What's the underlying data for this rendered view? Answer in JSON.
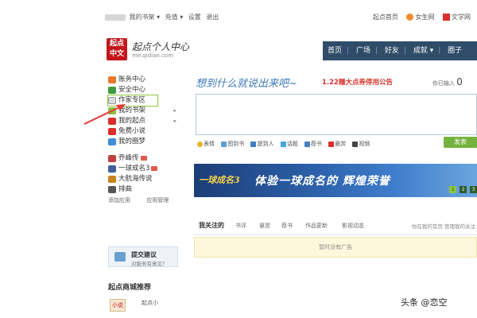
{
  "topbar": {
    "links_left": [
      "我的书架 ▾",
      "充值 ▾",
      "设置",
      "退出"
    ],
    "links_right": [
      "起点首页",
      "女生网",
      "文学网"
    ]
  },
  "header": {
    "logo_text": "起点中文",
    "site_title": "起点个人中心",
    "site_url": "me.qidian.com",
    "nav": [
      "首页",
      "广场",
      "好友",
      "成就 ▾",
      "圈子"
    ]
  },
  "sidebar": {
    "items": [
      {
        "label": "账务中心",
        "color": "#e87a2e",
        "arrow": false,
        "tag": false
      },
      {
        "label": "安全中心",
        "color": "#3f9b3f",
        "arrow": false,
        "tag": false
      },
      {
        "label": "作家专区",
        "color": "#dddddd",
        "arrow": false,
        "tag": false
      },
      {
        "label": "我的书架",
        "color": "#8cbf3f",
        "arrow": true,
        "tag": false
      },
      {
        "label": "我的起点",
        "color": "#d9302c",
        "arrow": true,
        "tag": false
      },
      {
        "label": "免费小说",
        "color": "#d9302c",
        "arrow": false,
        "tag": false
      },
      {
        "label": "我的圈梦",
        "color": "#3b8fd4",
        "arrow": false,
        "tag": false
      }
    ],
    "apps": [
      {
        "label": "乔峰传",
        "color": "#c43f3f",
        "tag": true
      },
      {
        "label": "一球成名3",
        "color": "#3f5f9f",
        "tag": true
      },
      {
        "label": "大航海传说",
        "color": "#c9831f",
        "tag": false
      },
      {
        "label": "排曲",
        "color": "#555555",
        "tag": false
      }
    ],
    "add_app": "添加应用",
    "manage_app": "应用管理",
    "suggest_title": "提交建议",
    "suggest_sub": "对服务有意见？",
    "mall_title": "起点商城推荐",
    "mall_book": "小说",
    "mall_text": "起点小"
  },
  "main": {
    "slogan": "想到什么就说出来吧~",
    "announcement": "1.22赚大点券停用公告",
    "word_count_label": "你已输入",
    "word_count_value": "0",
    "tools": [
      "表情",
      "图到书",
      "提到人",
      "话题",
      "荐书",
      "悬赏",
      "视频"
    ],
    "tool_colors": [
      "#e8b22e",
      "#5a9fd4",
      "#3f7fbf",
      "#3fa9df",
      "#4a7fc4",
      "#d9302c",
      "#444444"
    ],
    "publish_label": "发表",
    "banner": {
      "game_title": "一球成名3",
      "text": "体验一球成名的 辉煌荣誉",
      "pages": [
        "1",
        "2",
        "3"
      ],
      "active_page": 0
    },
    "tabs": [
      "我关注的",
      "书评",
      "悬赏",
      "荐书",
      "作品更新",
      "影视动态"
    ],
    "active_tab": 0,
    "tab_links": "你在我的首页 管理我的关注",
    "ad_text": "暂时没有广告"
  },
  "watermark": "头条 @恋空",
  "colors": {
    "nav_bg": "#2f4d69",
    "accent_red": "#d9302c",
    "publish_green": "#74b33d",
    "highlight_green": "#8cc63f",
    "arrow_red": "#e8393a"
  }
}
